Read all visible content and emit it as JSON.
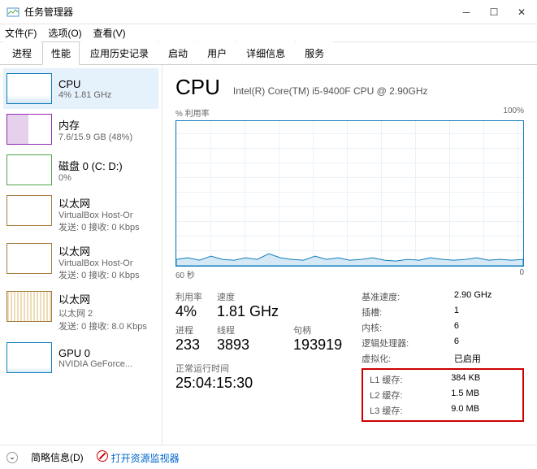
{
  "window": {
    "title": "任务管理器"
  },
  "menu": {
    "file": "文件(F)",
    "options": "选项(O)",
    "view": "查看(V)"
  },
  "tabs": [
    "进程",
    "性能",
    "应用历史记录",
    "启动",
    "用户",
    "详细信息",
    "服务"
  ],
  "sidebar": [
    {
      "title": "CPU",
      "sub": "4% 1.81 GHz"
    },
    {
      "title": "内存",
      "sub": "7.6/15.9 GB (48%)"
    },
    {
      "title": "磁盘 0 (C: D:)",
      "sub": "0%"
    },
    {
      "title": "以太网",
      "sub": "VirtualBox Host-Or",
      "sub2": "发送: 0 接收: 0 Kbps"
    },
    {
      "title": "以太网",
      "sub": "VirtualBox Host-Or",
      "sub2": "发送: 0 接收: 0 Kbps"
    },
    {
      "title": "以太网",
      "sub": "以太网 2",
      "sub2": "发送: 0 接收: 8.0 Kbps"
    },
    {
      "title": "GPU 0",
      "sub": "NVIDIA GeForce..."
    }
  ],
  "main": {
    "title": "CPU",
    "subtitle": "Intel(R) Core(TM) i5-9400F CPU @ 2.90GHz",
    "chart_ylabel": "% 利用率",
    "chart_ymax": "100%",
    "chart_xleft": "60 秒",
    "chart_xright": "0",
    "stats_top": [
      {
        "label": "利用率",
        "val": "4%"
      },
      {
        "label": "速度",
        "val": "1.81 GHz"
      }
    ],
    "stats_bottom": [
      {
        "label": "进程",
        "val": "233"
      },
      {
        "label": "线程",
        "val": "3893"
      },
      {
        "label": "句柄",
        "val": "193919"
      }
    ],
    "uptime_label": "正常运行时间",
    "uptime": "25:04:15:30",
    "kv": [
      {
        "k": "基准速度:",
        "v": "2.90 GHz"
      },
      {
        "k": "插槽:",
        "v": "1"
      },
      {
        "k": "内核:",
        "v": "6"
      },
      {
        "k": "逻辑处理器:",
        "v": "6"
      },
      {
        "k": "虚拟化:",
        "v": "已启用"
      }
    ],
    "kv_boxed": [
      {
        "k": "L1 缓存:",
        "v": "384 KB"
      },
      {
        "k": "L2 缓存:",
        "v": "1.5 MB"
      },
      {
        "k": "L3 缓存:",
        "v": "9.0 MB"
      }
    ]
  },
  "footer": {
    "brief": "简略信息(D)",
    "monitor": "打开资源监视器"
  },
  "chart_data": {
    "type": "line",
    "title": "% 利用率",
    "xlabel": "60 秒",
    "ylabel": "% 利用率",
    "xlim": [
      60,
      0
    ],
    "ylim": [
      0,
      100
    ],
    "series": [
      {
        "name": "CPU",
        "values": [
          5,
          6,
          4,
          7,
          5,
          4,
          6,
          5,
          8,
          6,
          5,
          4,
          7,
          5,
          6,
          4,
          5,
          6,
          4,
          3,
          5,
          4,
          6,
          5,
          4,
          5,
          6,
          4,
          5,
          4
        ]
      }
    ]
  }
}
